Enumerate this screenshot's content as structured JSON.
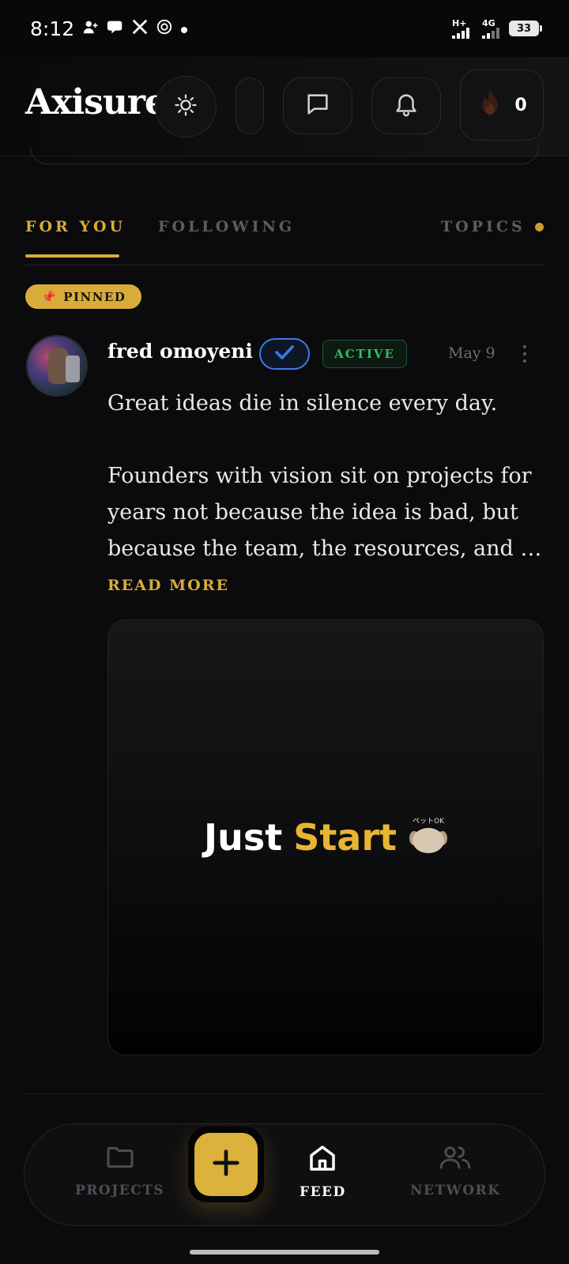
{
  "status_bar": {
    "time": "8:12",
    "notification_icons": [
      "person-add-icon",
      "chat-bubble-icon",
      "x-logo-icon",
      "openai-logo-icon",
      "dot-icon"
    ],
    "network_1": "H+",
    "network_2": "4G",
    "battery": "33"
  },
  "header": {
    "brand": "Axisure",
    "streak_count": "0",
    "icons": [
      "sun-icon",
      "chat-icon",
      "bell-icon",
      "flame-icon"
    ]
  },
  "tabs": {
    "for_you": "FOR YOU",
    "following": "FOLLOWING",
    "topics": "TOPICS",
    "active": "for_you"
  },
  "post": {
    "pinned_label": "PINNED",
    "pinned_emoji": "📌",
    "author": "fred omoyeni",
    "status": "ACTIVE",
    "date": "May 9",
    "body_line_1": "Great ideas die in silence every day.",
    "body_para_2_line_1": "Founders with vision sit on projects for",
    "body_para_2_line_2": "years not because the idea is bad, but",
    "body_para_2_line_3": "because the team, the resources, and th...",
    "read_more": "READ MORE",
    "media_text_1": "Just",
    "media_text_2": "Start",
    "media_sticker_tag": "ペットOK"
  },
  "bottom_nav": {
    "projects": "PROJECTS",
    "feed": "FEED",
    "network": "NETWORK",
    "active": "feed"
  },
  "colors": {
    "accent": "#d9ac3a",
    "background": "#0b0b0d",
    "verified": "#3a7be8",
    "active_green": "#2fbf5f"
  }
}
